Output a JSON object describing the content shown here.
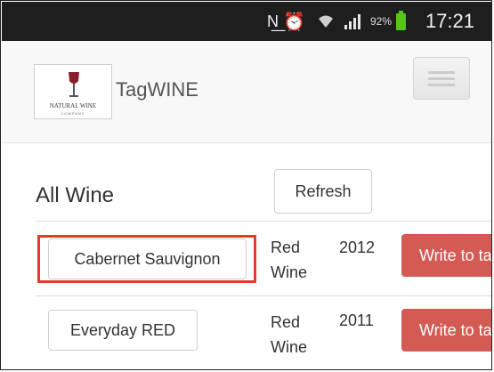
{
  "statusbar": {
    "time": "17:21",
    "battery": "92%",
    "icons": [
      "nfc-icon",
      "alarm-icon",
      "wifi-icon",
      "signal-icon",
      "battery-icon"
    ]
  },
  "navbar": {
    "brand": "TagWINE",
    "logo": {
      "line1": "NATURAL WINE",
      "line2": "COMPANY"
    },
    "menu_icon": "hamburger-menu-icon"
  },
  "main": {
    "title": "All Wine",
    "refresh_label": "Refresh",
    "wines": [
      {
        "name": "Cabernet Sauvignon",
        "type_line1": "Red",
        "type_line2": "Wine",
        "year": "2012",
        "action": "Write to tag",
        "highlighted": true
      },
      {
        "name": "Everyday RED",
        "type_line1": "Red",
        "type_line2": "Wine",
        "year": "2011",
        "action": "Write to tag",
        "highlighted": false
      }
    ]
  },
  "colors": {
    "action": "#d45a54",
    "highlight": "#e33b2b",
    "battery": "#55c51e"
  }
}
